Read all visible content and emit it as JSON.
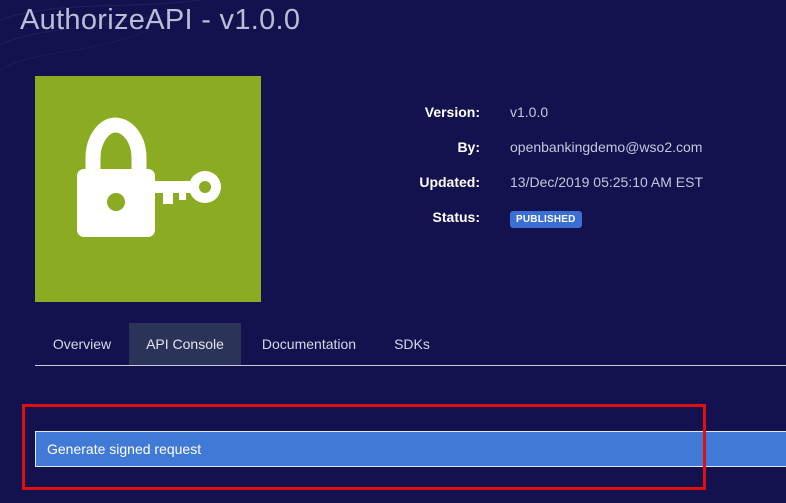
{
  "api": {
    "title": "AuthorizeAPI - v1.0.0"
  },
  "thumbnail": {
    "icon": "lock-key-icon",
    "background_color": "#8aab22"
  },
  "meta": {
    "version_label": "Version:",
    "version_value": "v1.0.0",
    "by_label": "By:",
    "by_value": "openbankingdemo@wso2.com",
    "updated_label": "Updated:",
    "updated_value": "13/Dec/2019 05:25:10 AM EST",
    "status_label": "Status:",
    "status_value": "PUBLISHED"
  },
  "tabs": [
    {
      "label": "Overview",
      "active": false
    },
    {
      "label": "API Console",
      "active": true
    },
    {
      "label": "Documentation",
      "active": false
    },
    {
      "label": "SDKs",
      "active": false
    }
  ],
  "action": {
    "label": "Generate signed request"
  },
  "colors": {
    "background": "#13124f",
    "accent": "#4179d6",
    "status_badge": "#3b6fd3",
    "highlight": "#e01010"
  }
}
